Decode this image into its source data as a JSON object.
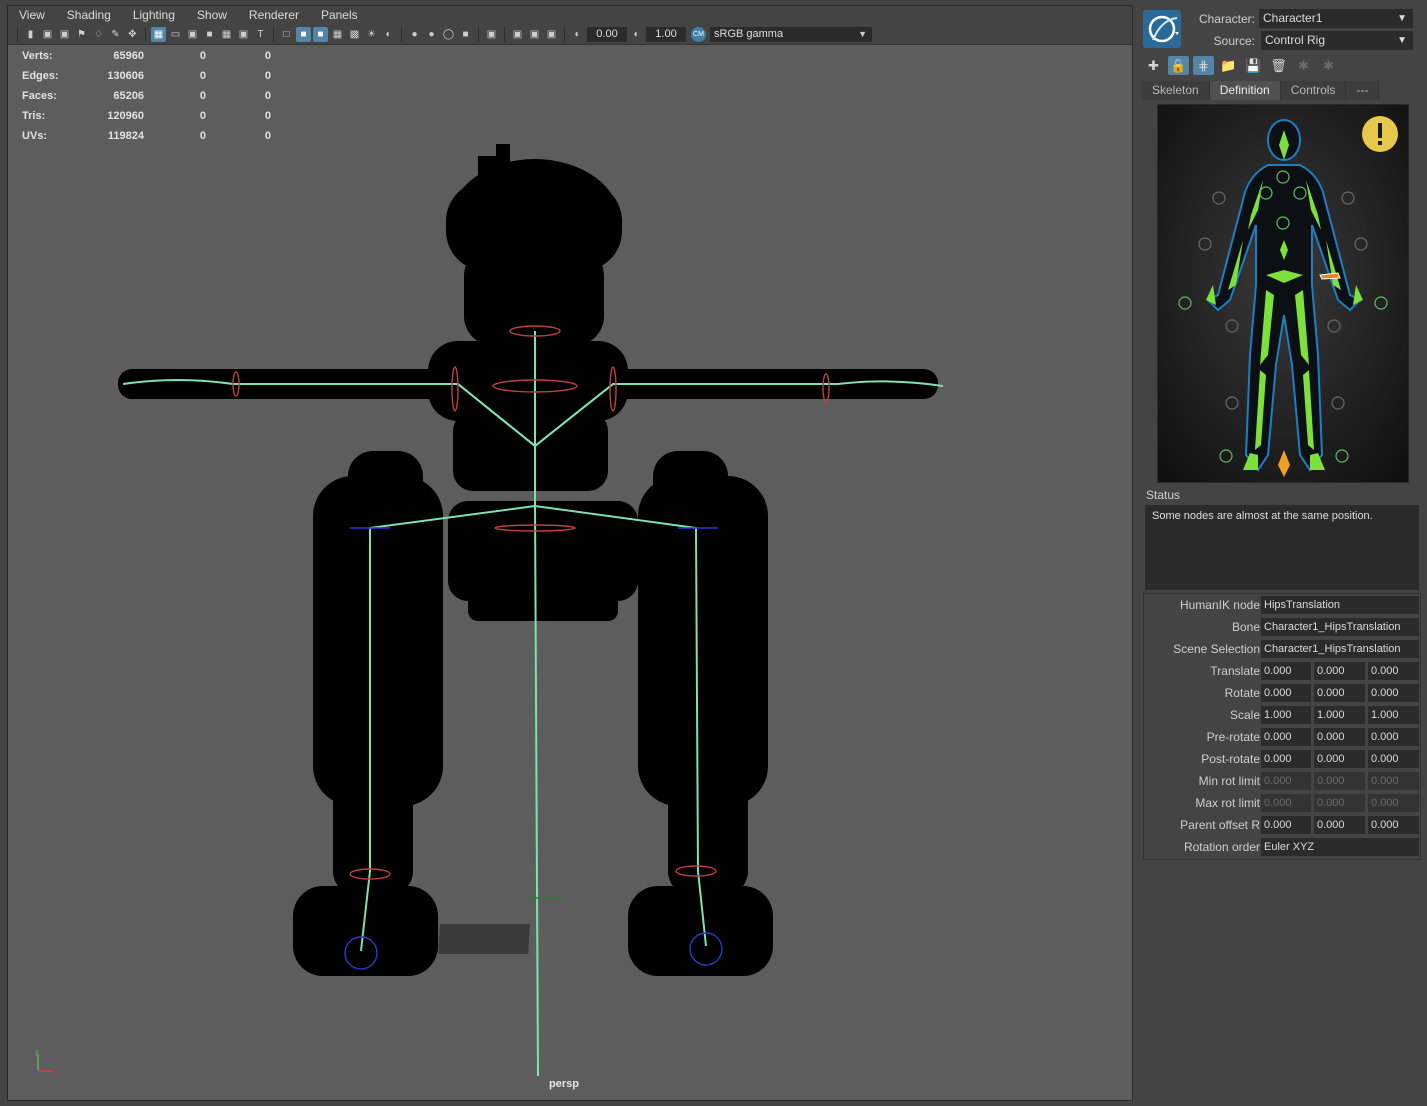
{
  "viewport": {
    "menu": [
      "View",
      "Shading",
      "Lighting",
      "Show",
      "Renderer",
      "Panels"
    ],
    "toolbar": {
      "field_a": "0.00",
      "field_b": "1.00",
      "gamma": "sRGB gamma"
    },
    "hud": [
      {
        "label": "Verts:",
        "v1": "65960",
        "v2": "0",
        "v3": "0"
      },
      {
        "label": "Edges:",
        "v1": "130606",
        "v2": "0",
        "v3": "0"
      },
      {
        "label": "Faces:",
        "v1": "65206",
        "v2": "0",
        "v3": "0"
      },
      {
        "label": "Tris:",
        "v1": "120960",
        "v2": "0",
        "v3": "0"
      },
      {
        "label": "UVs:",
        "v1": "119824",
        "v2": "0",
        "v3": "0"
      }
    ],
    "camera": "persp",
    "axis": {
      "y": "y",
      "x": "x"
    }
  },
  "hik": {
    "character_label": "Character:",
    "character_value": "Character1",
    "source_label": "Source:",
    "source_value": "Control Rig",
    "tabs": [
      "Skeleton",
      "Definition",
      "Controls",
      "---"
    ],
    "active_tab": "Definition",
    "status_label": "Status",
    "status_text": "Some nodes are almost at the same position.",
    "props": {
      "humanik_node": {
        "label": "HumanIK node",
        "value": "HipsTranslation"
      },
      "bone": {
        "label": "Bone",
        "value": "Character1_HipsTranslation"
      },
      "scene_selection": {
        "label": "Scene Selection",
        "value": "Character1_HipsTranslation"
      },
      "translate": {
        "label": "Translate",
        "v": [
          "0.000",
          "0.000",
          "0.000"
        ]
      },
      "rotate": {
        "label": "Rotate",
        "v": [
          "0.000",
          "0.000",
          "0.000"
        ]
      },
      "scale": {
        "label": "Scale",
        "v": [
          "1.000",
          "1.000",
          "1.000"
        ]
      },
      "pre_rotate": {
        "label": "Pre-rotate",
        "v": [
          "0.000",
          "0.000",
          "0.000"
        ]
      },
      "post_rotate": {
        "label": "Post-rotate",
        "v": [
          "0.000",
          "0.000",
          "0.000"
        ]
      },
      "min_rot_limit": {
        "label": "Min rot limit",
        "v": [
          "0.000",
          "0.000",
          "0.000"
        ]
      },
      "max_rot_limit": {
        "label": "Max rot limit",
        "v": [
          "0.000",
          "0.000",
          "0.000"
        ]
      },
      "parent_offset_r": {
        "label": "Parent offset R",
        "v": [
          "0.000",
          "0.000",
          "0.000"
        ]
      },
      "rotation_order": {
        "label": "Rotation order",
        "value": "Euler XYZ"
      }
    }
  },
  "colors": {
    "viewport_bg": "#5d5d5d",
    "joint": "#7fe0b0",
    "accent": "#5285a6",
    "limb": "#7de03c",
    "warning": "#e0c040"
  }
}
